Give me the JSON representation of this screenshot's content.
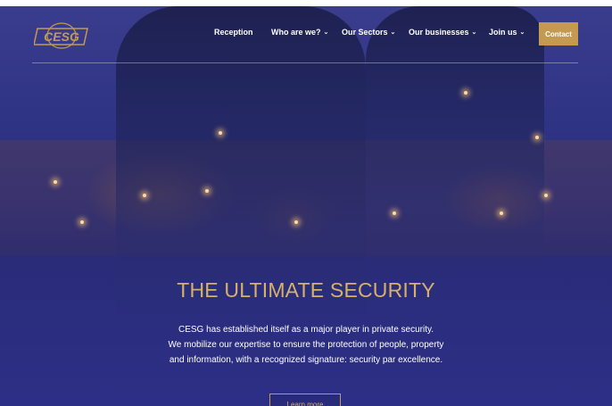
{
  "brand": {
    "logo_text": "CESG",
    "accent_color": "#c49a50",
    "headline_color": "#d8b06a"
  },
  "nav": {
    "items": [
      {
        "label": "Reception",
        "has_dropdown": false
      },
      {
        "label": "Who are we?",
        "has_dropdown": true
      },
      {
        "label": "Our Sectors",
        "has_dropdown": true
      },
      {
        "label": "Our businesses",
        "has_dropdown": true
      },
      {
        "label": "Join us",
        "has_dropdown": true
      }
    ],
    "contact_label": "Contact",
    "dropdown_icon": "chevron-down-icon"
  },
  "hero": {
    "headline": "THE ULTIMATE SECURITY",
    "tagline_lines": [
      "CESG has established itself as a major player in private security.",
      "We mobilize our expertise to ensure the protection of people, property",
      "and information, with a recognized signature: security par excellence."
    ],
    "cta_label": "Learn more"
  }
}
